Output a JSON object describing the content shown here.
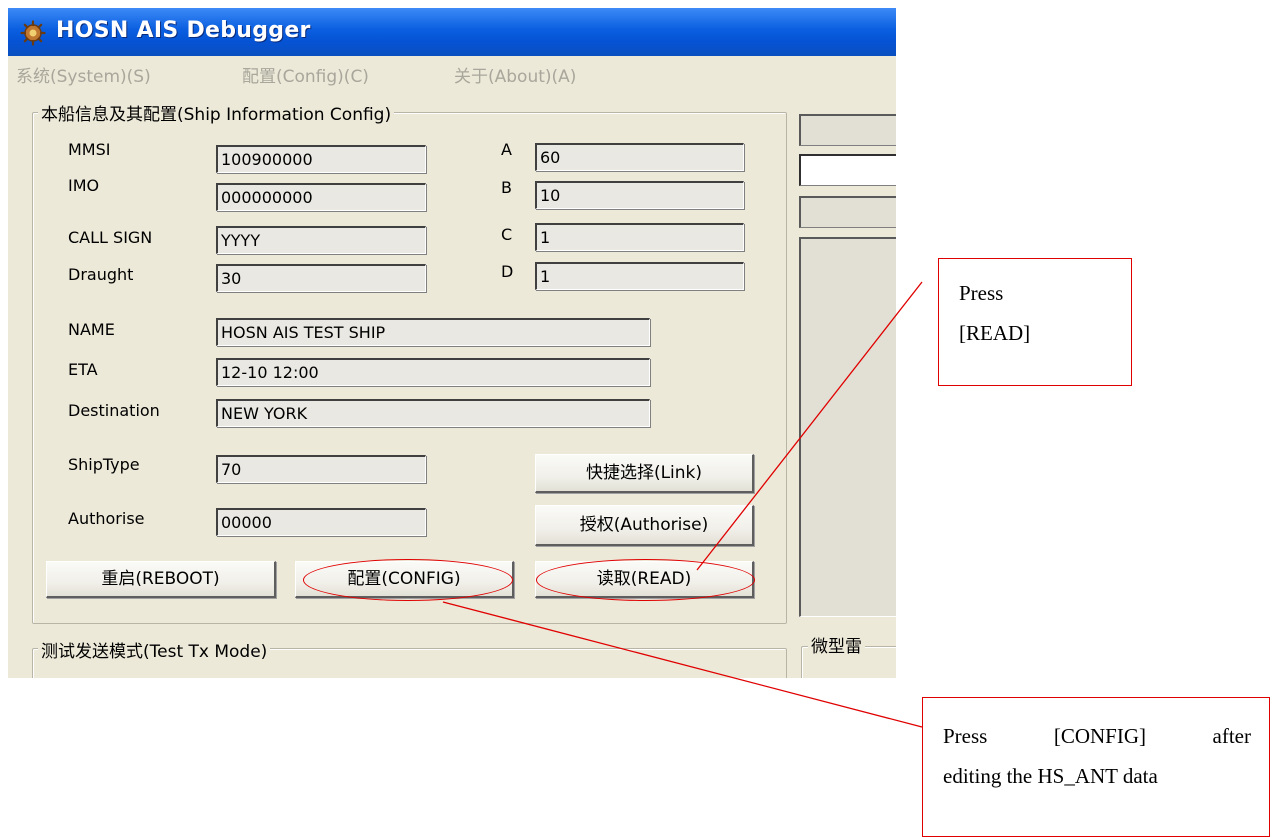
{
  "window": {
    "title": "HOSN AIS Debugger",
    "menu": [
      "系统(System)(S)",
      "配置(Config)(C)",
      "关于(About)(A)"
    ]
  },
  "ship_config": {
    "legend": "本船信息及其配置(Ship Information Config)",
    "mmsi_label": "MMSI",
    "mmsi": "100900000",
    "imo_label": "IMO",
    "imo": "000000000",
    "callsign_label": "CALL SIGN",
    "callsign": "YYYY",
    "draught_label": "Draught",
    "draught": "30",
    "a_label": "A",
    "a": "60",
    "b_label": "B",
    "b": "10",
    "c_label": "C",
    "c": "1",
    "d_label": "D",
    "d": "1",
    "name_label": "NAME",
    "name": "HOSN AIS TEST SHIP",
    "eta_label": "ETA",
    "eta": "12-10 12:00",
    "destination_label": "Destination",
    "destination": "NEW YORK",
    "shiptype_label": "ShipType",
    "shiptype": "70",
    "authorise_label": "Authorise",
    "authorise": "00000",
    "link_button": "快捷选择(Link)",
    "authorise_button": "授权(Authorise)",
    "reboot_button": "重启(REBOOT)",
    "config_button": "配置(CONFIG)",
    "read_button": "读取(READ)"
  },
  "test_tx": {
    "legend": "测试发送模式(Test Tx Mode)"
  },
  "right": {
    "legend_partial": "微型雷"
  },
  "annotations": {
    "read_line1": "Press",
    "read_line2": "[READ]",
    "config_line1_a": "Press",
    "config_line1_b": "[CONFIG]",
    "config_line1_c": "after",
    "config_line2": "editing the HS_ANT data"
  },
  "colors": {
    "annotation": "#e00000",
    "title_bar": "#0a5fe0",
    "window_bg": "#ece9d8"
  }
}
